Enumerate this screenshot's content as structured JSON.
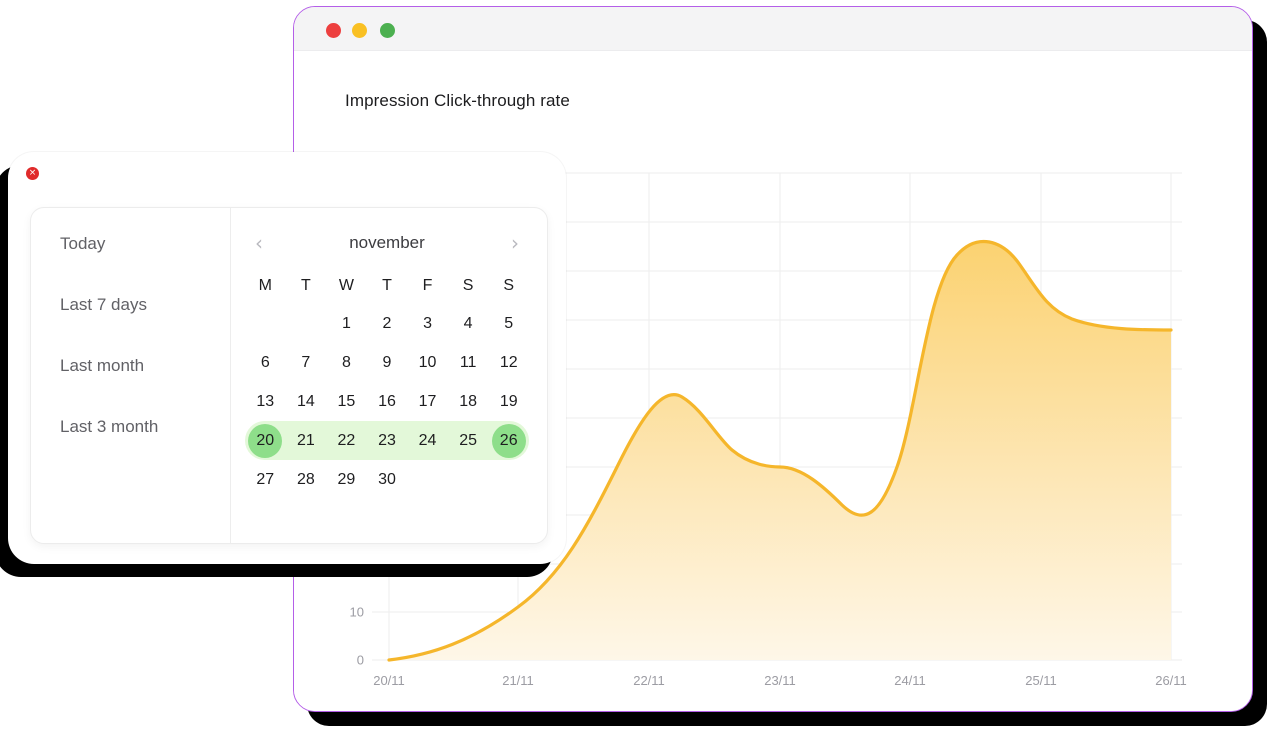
{
  "browser_window": {
    "traffic_lights": [
      {
        "name": "close",
        "color": "#ed3f3f"
      },
      {
        "name": "minimize",
        "color": "#f9c023"
      },
      {
        "name": "maximize",
        "color": "#4cb050"
      }
    ],
    "border_color": "#b45ee8"
  },
  "chart_panel": {
    "title": "Impression Click-through rate"
  },
  "chart_data": {
    "type": "area",
    "title": "Impression Click-through rate",
    "xlabel": "",
    "ylabel": "",
    "categories": [
      "20/11",
      "21/11",
      "22/11",
      "23/11",
      "24/11",
      "25/11",
      "26/11"
    ],
    "x_tick_labels": [
      "20/11",
      "21/11",
      "22/11",
      "23/11",
      "24/11",
      "25/11",
      "26/11"
    ],
    "y_tick_labels": [
      "10",
      "0"
    ],
    "y_ticks": [
      0,
      10
    ],
    "ylim": [
      0,
      100
    ],
    "grid": true,
    "legend": "none",
    "line_color": "#F5B62B",
    "fill_top_color": "#FBD886",
    "fill_bottom_color": "#FEF6E4",
    "series": [
      {
        "name": "Click-through rate",
        "values": [
          0,
          10,
          38,
          49,
          30,
          93,
          75
        ],
        "points": [
          {
            "x": "20/11",
            "y": 0
          },
          {
            "x": "21/11",
            "y": 10
          },
          {
            "x": "22/11",
            "y": 38
          },
          {
            "x": "23/11",
            "y": 49
          },
          {
            "x": "24/11",
            "y": 30
          },
          {
            "x": "25/11",
            "y": 93
          },
          {
            "x": "26/11",
            "y": 75
          }
        ]
      }
    ]
  },
  "calendar_window": {
    "close_icon": "×",
    "presets": [
      {
        "label": "Today"
      },
      {
        "label": "Last 7 days"
      },
      {
        "label": "Last month"
      },
      {
        "label": "Last 3 month"
      }
    ],
    "calendar": {
      "month_label": "november",
      "prev_icon": "‹",
      "next_icon": "›",
      "weekdays": [
        "M",
        "T",
        "W",
        "T",
        "F",
        "S",
        "S"
      ],
      "leading_blanks": 2,
      "days": [
        {
          "n": "1"
        },
        {
          "n": "2"
        },
        {
          "n": "3"
        },
        {
          "n": "4"
        },
        {
          "n": "5"
        },
        {
          "n": "6"
        },
        {
          "n": "7"
        },
        {
          "n": "8"
        },
        {
          "n": "9"
        },
        {
          "n": "10"
        },
        {
          "n": "11"
        },
        {
          "n": "12"
        },
        {
          "n": "13"
        },
        {
          "n": "14"
        },
        {
          "n": "15"
        },
        {
          "n": "16"
        },
        {
          "n": "17"
        },
        {
          "n": "18"
        },
        {
          "n": "19"
        },
        {
          "n": "20",
          "state": "range-start"
        },
        {
          "n": "21",
          "state": "in-range"
        },
        {
          "n": "22",
          "state": "in-range"
        },
        {
          "n": "23",
          "state": "in-range"
        },
        {
          "n": "24",
          "state": "in-range"
        },
        {
          "n": "25",
          "state": "in-range"
        },
        {
          "n": "26",
          "state": "range-end"
        },
        {
          "n": "27"
        },
        {
          "n": "28"
        },
        {
          "n": "29"
        },
        {
          "n": "30"
        }
      ],
      "selected_range": {
        "start": "20",
        "end": "26"
      },
      "range_band_color": "#e3f8d9",
      "endpoint_color": "#8ede8a"
    }
  }
}
